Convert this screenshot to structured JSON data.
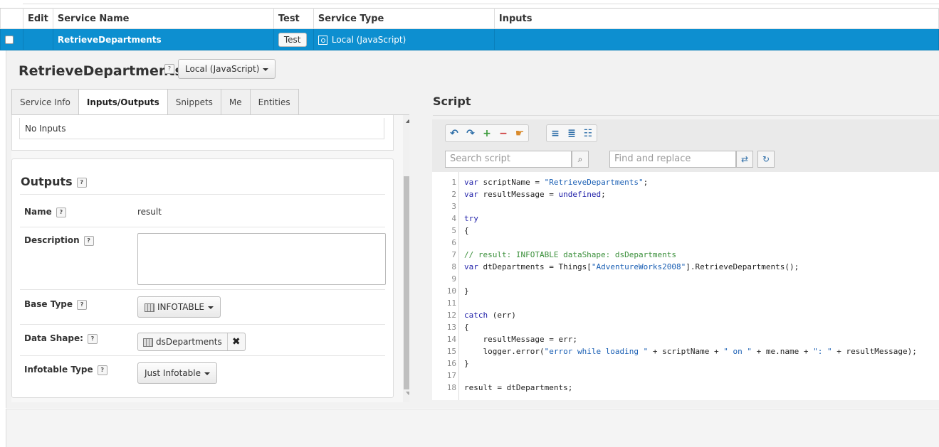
{
  "table": {
    "headers": [
      "Edit",
      "Service Name",
      "Test",
      "Service Type",
      "Inputs"
    ],
    "row": {
      "service_name": "RetrieveDepartments",
      "test_label": "Test",
      "service_type": "Local (JavaScript)",
      "inputs": ""
    }
  },
  "detail": {
    "title": "RetrieveDepartments",
    "help_glyph": "?",
    "type_dropdown": "Local (JavaScript)",
    "tabs": [
      "Service Info",
      "Inputs/Outputs",
      "Snippets",
      "Me",
      "Entities"
    ],
    "active_tab": "Inputs/Outputs",
    "no_inputs": "No Inputs",
    "outputs": {
      "title": "Outputs",
      "name_label": "Name",
      "name_value": "result",
      "description_label": "Description",
      "description_value": "",
      "base_type_label": "Base Type",
      "base_type_value": "INFOTABLE",
      "data_shape_label": "Data Shape:",
      "data_shape_value": "dsDepartments",
      "remove_glyph": "✖",
      "infotable_type_label": "Infotable Type",
      "infotable_type_value": "Just Infotable"
    }
  },
  "script": {
    "title": "Script",
    "search_placeholder": "Search script",
    "replace_placeholder": "Find and replace",
    "toolbar_icons": [
      "undo-icon",
      "redo-icon",
      "add-snippet-icon",
      "remove-snippet-icon",
      "hand-icon",
      "align-left-icon",
      "align-center-icon",
      "format-icon"
    ],
    "lines": [
      {
        "n": "1",
        "code": "var scriptName = \"RetrieveDepartments\";"
      },
      {
        "n": "2",
        "code": "var resultMessage = undefined;"
      },
      {
        "n": "3",
        "code": ""
      },
      {
        "n": "4",
        "code": "try"
      },
      {
        "n": "5",
        "code": "{"
      },
      {
        "n": "6",
        "code": ""
      },
      {
        "n": "7",
        "code": "// result: INFOTABLE dataShape: dsDepartments"
      },
      {
        "n": "8",
        "code": "var dtDepartments = Things[\"AdventureWorks2008\"].RetrieveDepartments();"
      },
      {
        "n": "9",
        "code": ""
      },
      {
        "n": "10",
        "code": "}"
      },
      {
        "n": "11",
        "code": ""
      },
      {
        "n": "12",
        "code": "catch (err)"
      },
      {
        "n": "13",
        "code": "{"
      },
      {
        "n": "14",
        "code": "    resultMessage = err;"
      },
      {
        "n": "15",
        "code": "    logger.error(\"error while loading \" + scriptName + \" on \" + me.name + \": \" + resultMessage);"
      },
      {
        "n": "16",
        "code": "}"
      },
      {
        "n": "17",
        "code": ""
      },
      {
        "n": "18",
        "code": "result = dtDepartments;"
      }
    ]
  },
  "colors": {
    "selected_row": "#0d8fd0",
    "code_keyword": "#1e1ea8",
    "code_string": "#1a5fb4",
    "code_comment": "#3a8f3a"
  }
}
